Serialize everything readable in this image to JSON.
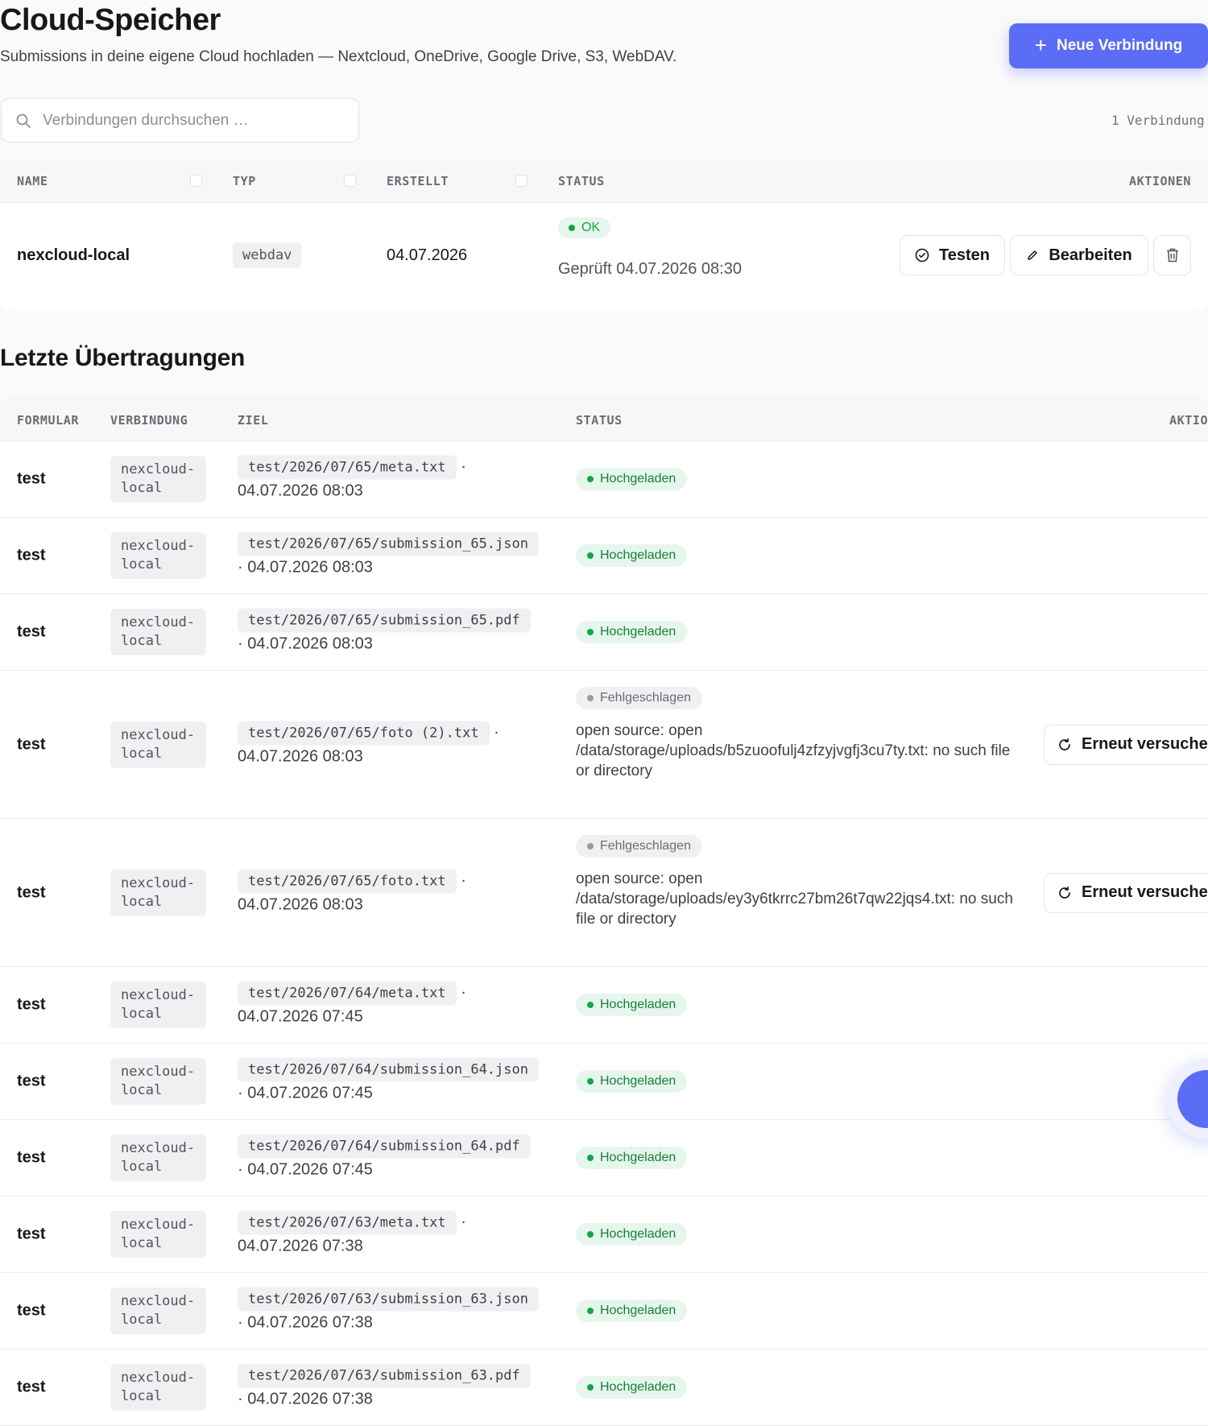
{
  "header": {
    "title": "Cloud-Speicher",
    "subtitle": "Submissions in deine eigene Cloud hochladen — Nextcloud, OneDrive, Google Drive, S3, WebDAV.",
    "new_button": "Neue Verbindung"
  },
  "search": {
    "placeholder": "Verbindungen durchsuchen …",
    "count": "1 Verbindung"
  },
  "connections": {
    "columns": [
      "NAME",
      "TYP",
      "ERSTELLT",
      "STATUS",
      "AKTIONEN"
    ],
    "rows": [
      {
        "name": "nexcloud-local",
        "type": "webdav",
        "created": "04.07.2026",
        "status": "OK",
        "checked": "Geprüft 04.07.2026 08:30",
        "test_label": "Testen",
        "edit_label": "Bearbeiten"
      }
    ]
  },
  "transfers": {
    "title": "Letzte Übertragungen",
    "columns": [
      "FORMULAR",
      "VERBINDUNG",
      "ZIEL",
      "STATUS",
      "AKTIO"
    ],
    "retry_label": "Erneut versuche",
    "rows": [
      {
        "form": "test",
        "conn": "nexcloud-local",
        "path": "test/2026/07/65/meta.txt",
        "time": "04.07.2026 08:03",
        "status": "Hochgeladen",
        "error": ""
      },
      {
        "form": "test",
        "conn": "nexcloud-local",
        "path": "test/2026/07/65/submission_65.json",
        "time": "04.07.2026 08:03",
        "status": "Hochgeladen",
        "error": ""
      },
      {
        "form": "test",
        "conn": "nexcloud-local",
        "path": "test/2026/07/65/submission_65.pdf",
        "time": "04.07.2026 08:03",
        "status": "Hochgeladen",
        "error": ""
      },
      {
        "form": "test",
        "conn": "nexcloud-local",
        "path": "test/2026/07/65/foto (2).txt",
        "time": "04.07.2026 08:03",
        "status": "Fehlgeschlagen",
        "error": "open source: open /data/storage/uploads/b5zuoofulj4zfzyjvgfj3cu7ty.txt: no such file or directory"
      },
      {
        "form": "test",
        "conn": "nexcloud-local",
        "path": "test/2026/07/65/foto.txt",
        "time": "04.07.2026 08:03",
        "status": "Fehlgeschlagen",
        "error": "open source: open /data/storage/uploads/ey3y6tkrrc27bm26t7qw22jqs4.txt: no such file or directory"
      },
      {
        "form": "test",
        "conn": "nexcloud-local",
        "path": "test/2026/07/64/meta.txt",
        "time": "04.07.2026 07:45",
        "status": "Hochgeladen",
        "error": ""
      },
      {
        "form": "test",
        "conn": "nexcloud-local",
        "path": "test/2026/07/64/submission_64.json",
        "time": "04.07.2026 07:45",
        "status": "Hochgeladen",
        "error": ""
      },
      {
        "form": "test",
        "conn": "nexcloud-local",
        "path": "test/2026/07/64/submission_64.pdf",
        "time": "04.07.2026 07:45",
        "status": "Hochgeladen",
        "error": ""
      },
      {
        "form": "test",
        "conn": "nexcloud-local",
        "path": "test/2026/07/63/meta.txt",
        "time": "04.07.2026 07:38",
        "status": "Hochgeladen",
        "error": ""
      },
      {
        "form": "test",
        "conn": "nexcloud-local",
        "path": "test/2026/07/63/submission_63.json",
        "time": "04.07.2026 07:38",
        "status": "Hochgeladen",
        "error": ""
      },
      {
        "form": "test",
        "conn": "nexcloud-local",
        "path": "test/2026/07/63/submission_63.pdf",
        "time": "04.07.2026 07:38",
        "status": "Hochgeladen",
        "error": ""
      }
    ]
  },
  "colors": {
    "accent": "#5b6cf5",
    "success": "#16a34a",
    "success_bg": "#e6f6ec",
    "neutral_badge": "#f0f0f2"
  },
  "icons": {
    "new_button": "plus-icon",
    "search": "search-icon",
    "test": "check-circle-icon",
    "edit": "pencil-icon",
    "delete": "trash-icon",
    "retry": "refresh-icon",
    "assistant": "assistant-icon"
  }
}
